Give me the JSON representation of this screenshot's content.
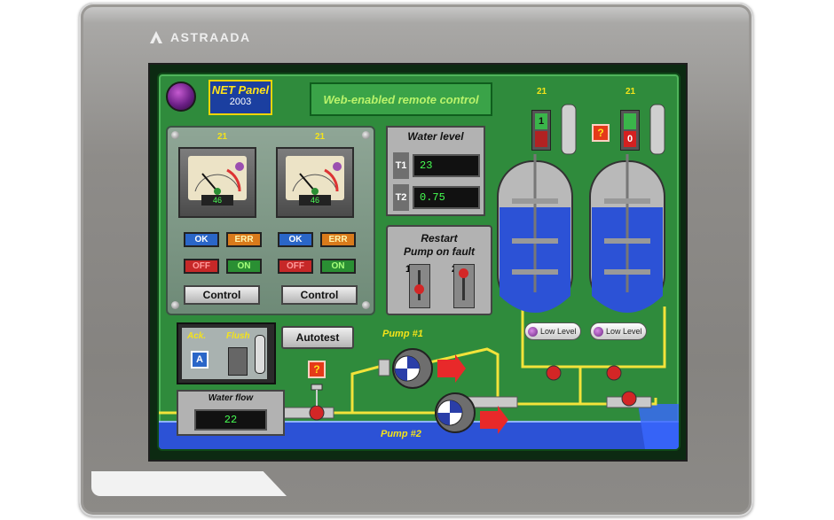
{
  "brand": {
    "name": "ASTRAADA",
    "logo_icon": "astraada-logo-icon"
  },
  "header": {
    "net_panel_title": "NET Panel",
    "net_panel_year": "2003",
    "web_label": "Web-enabled remote control"
  },
  "gauges": [
    {
      "label_top": "21",
      "reading": "46",
      "buttons": {
        "ok": "OK",
        "err": "ERR",
        "off": "OFF",
        "on": "ON",
        "control": "Control"
      }
    },
    {
      "label_top": "21",
      "reading": "46",
      "buttons": {
        "ok": "OK",
        "err": "ERR",
        "off": "OFF",
        "on": "ON",
        "control": "Control"
      }
    }
  ],
  "water_level": {
    "title": "Water level",
    "t1_label": "T1",
    "t1_value": "23",
    "t2_label": "T2",
    "t2_value": "0.75"
  },
  "restart": {
    "title_line1": "Restart",
    "title_line2": "Pump on fault",
    "switch1": "1",
    "switch2": "2"
  },
  "flush_panel": {
    "ack": "Ack.",
    "flush": "Flush",
    "ack_button": "A"
  },
  "autotest": {
    "label": "Autotest"
  },
  "help_button": {
    "label": "?"
  },
  "water_flow": {
    "title": "Water flow",
    "value": "22"
  },
  "pumps": {
    "pump1": "Pump #1",
    "pump2": "Pump #2"
  },
  "tanks": [
    {
      "label_top": "21",
      "indicator": "1",
      "low_level": "Low Level"
    },
    {
      "label_top": "21",
      "indicator": "0",
      "low_level": "Low Level"
    }
  ],
  "colors": {
    "hmi_background": "#2f8b3c",
    "water": "#2c52d6",
    "pipe_yellow": "#f3e33a",
    "alarm_red": "#e53a19",
    "lcd_green": "#46ff52"
  }
}
